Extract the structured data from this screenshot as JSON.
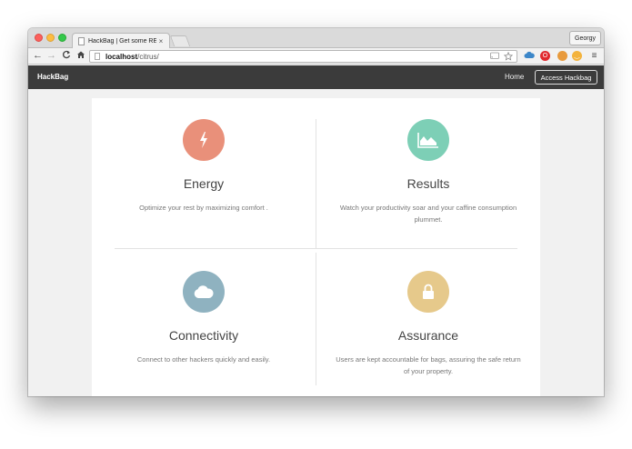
{
  "browser": {
    "tab_title": "HackBag | Get some REST",
    "tab_close": "×",
    "profile_name": "Georgy",
    "url_host": "localhost",
    "url_path": "/citrus/",
    "back_glyph": "←",
    "forward_glyph": "→",
    "reload_glyph": "C",
    "home_glyph": "⌂",
    "menu_glyph": "≡"
  },
  "navbar": {
    "brand": "HackBag",
    "home_link": "Home",
    "access_button": "Access Hackbag"
  },
  "features": [
    {
      "title": "Energy",
      "description": "Optimize your rest by maximizing comfort .",
      "icon": "lightning-icon",
      "color": "#e9907a"
    },
    {
      "title": "Results",
      "description": "Watch your productivity soar and your caffine consumption plummet.",
      "icon": "area-chart-icon",
      "color": "#7dcfb6"
    },
    {
      "title": "Connectivity",
      "description": "Connect to other hackers quickly and easily.",
      "icon": "cloud-icon",
      "color": "#8fb2c0"
    },
    {
      "title": "Assurance",
      "description": "Users are kept accountable for bags, assuring the safe return of your property.",
      "icon": "lock-icon",
      "color": "#e6c98b"
    }
  ]
}
